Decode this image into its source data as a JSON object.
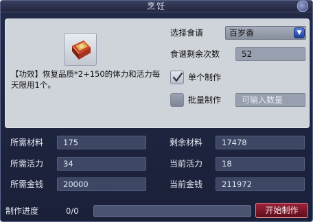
{
  "window": {
    "title": "烹饪"
  },
  "recipe": {
    "select_label": "选择食谱",
    "selected_recipe": "百岁香",
    "remaining_uses_label": "食谱剩余次数",
    "remaining_uses": "52"
  },
  "item": {
    "icon": "recipe-book-icon",
    "effect_text": "【功效】恢复品质*2+150的体力和活力每天限用1个。"
  },
  "options": {
    "single_label": "单个制作",
    "single_checked": true,
    "batch_label": "批量制作",
    "batch_checked": false,
    "batch_placeholder": "可输入数量"
  },
  "stats": {
    "required_material_label": "所需材料",
    "required_material": "175",
    "remaining_material_label": "剩余材料",
    "remaining_material": "17478",
    "required_vigor_label": "所需活力",
    "required_vigor": "34",
    "current_vigor_label": "当前活力",
    "current_vigor": "18",
    "required_money_label": "所需金钱",
    "required_money": "20000",
    "current_money_label": "当前金钱",
    "current_money": "211972"
  },
  "progress": {
    "label": "制作进度",
    "text": "0/0",
    "fraction": 0
  },
  "actions": {
    "start_label": "开始制作"
  },
  "colors": {
    "panel_bg": "#cfd3da",
    "window_bg": "#1f2540",
    "start_button": "#7a1a2c",
    "dropdown_arrow": "#2c52c4"
  }
}
